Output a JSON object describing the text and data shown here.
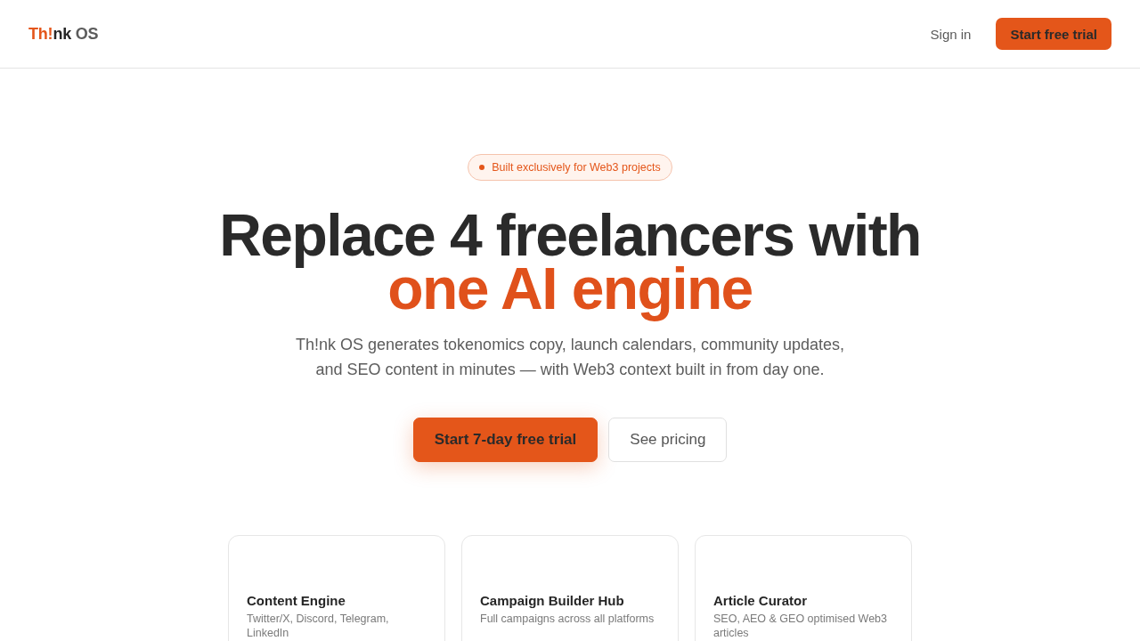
{
  "header": {
    "logo": [
      {
        "text": "Th!",
        "kind": "accent"
      },
      {
        "text": "nk",
        "kind": "dark"
      },
      {
        "text": " OS",
        "kind": "muted"
      }
    ],
    "sign_in": "Sign in",
    "cta": "Start free trial"
  },
  "hero": {
    "badge": "Built exclusively for Web3 projects",
    "headline": "Replace 4 freelancers with",
    "headline_accent": "one AI engine",
    "subtitle": "Th!nk OS generates tokenomics copy, launch calendars, community updates, and SEO content in minutes — with Web3 context built in from day one.",
    "buttons": [
      {
        "label": "Start 7-day free trial",
        "kind": "primary"
      },
      {
        "label": "See pricing",
        "kind": "secondary"
      }
    ]
  },
  "features": [
    {
      "title": "Content Engine",
      "description": "Twitter/X, Discord, Telegram, LinkedIn"
    },
    {
      "title": "Campaign Builder Hub",
      "description": "Full campaigns across all platforms"
    },
    {
      "title": "Article Curator",
      "description": "SEO, AEO & GEO optimised Web3 articles"
    }
  ]
}
